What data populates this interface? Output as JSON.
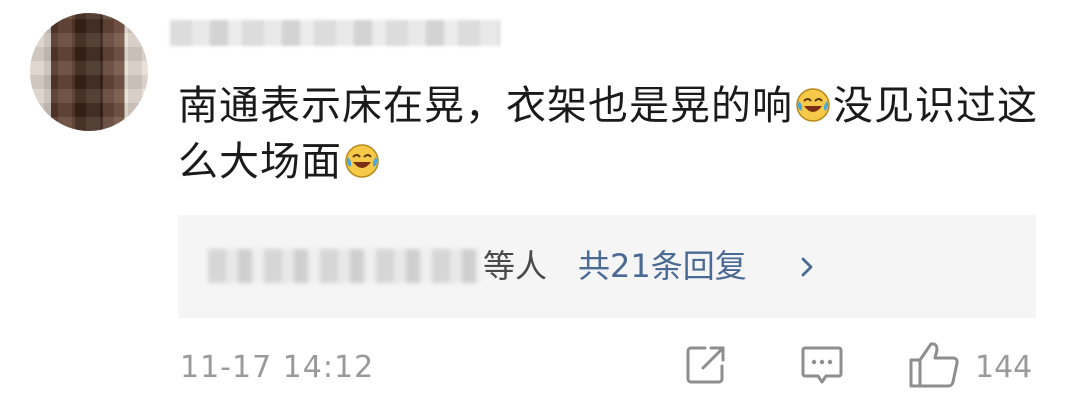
{
  "comment": {
    "username": "",
    "text_part1": "南通表示床在晃，衣架也是晃的响",
    "text_part2": "没见识过这么大场面",
    "emoji": "laughing-crying-emoji"
  },
  "replies": {
    "names": "",
    "etc_label": "等人",
    "count_label": "共21条回复",
    "chevron": "chevron-right-icon"
  },
  "footer": {
    "timestamp": "11-17 14:12",
    "like_count": "144",
    "icons": [
      "share-icon",
      "comment-icon",
      "like-icon"
    ]
  }
}
